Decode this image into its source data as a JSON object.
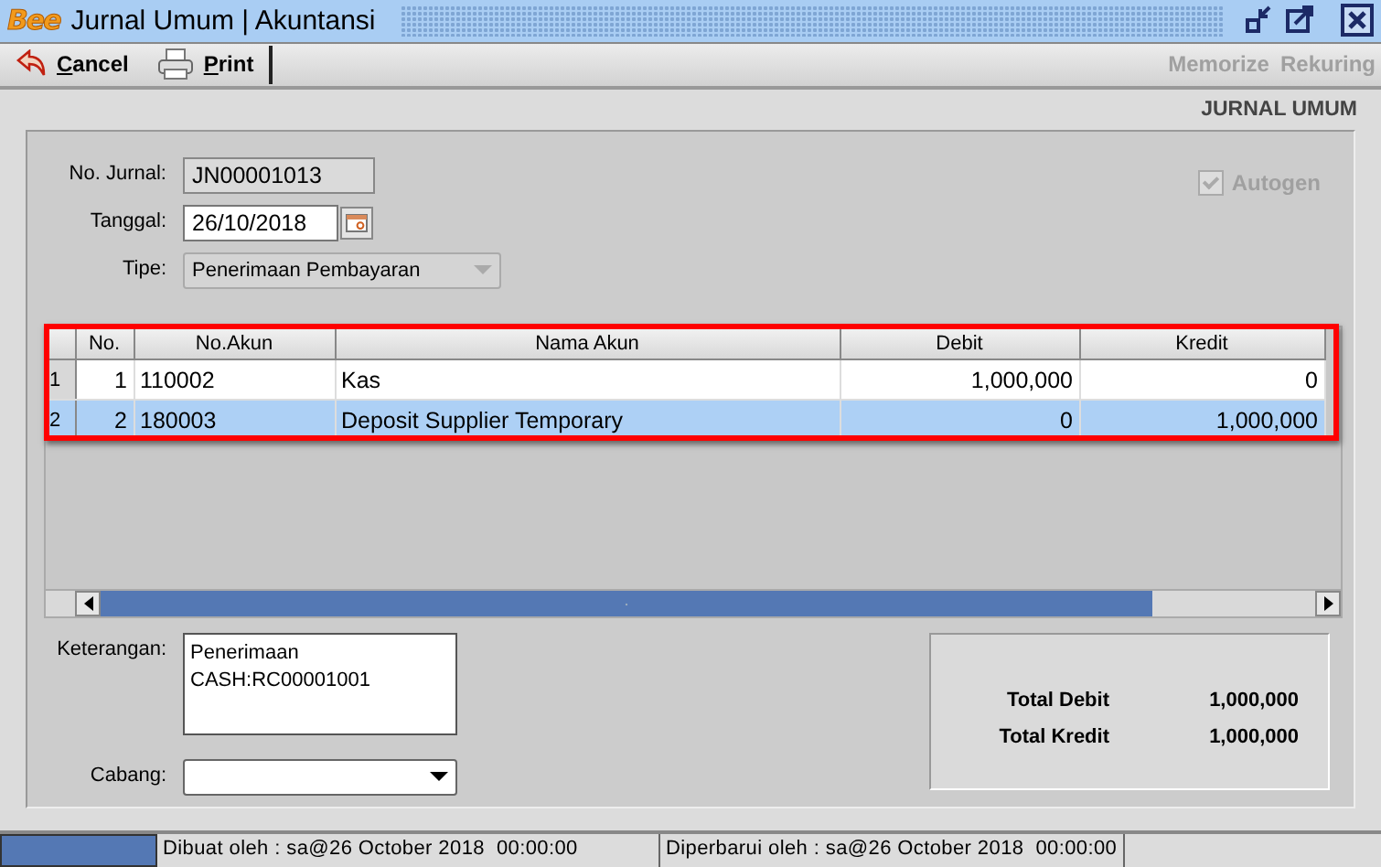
{
  "window": {
    "logo": "Bee",
    "title": "Jurnal Umum | Akuntansi"
  },
  "toolbar": {
    "left": [
      {
        "label": "Cancel"
      },
      {
        "label": "Print"
      }
    ],
    "right": [
      {
        "label": "Memorize",
        "disabled": true
      },
      {
        "label": "Rekuring",
        "disabled": true
      }
    ]
  },
  "form": {
    "heading": "JURNAL UMUM",
    "no_jurnal": {
      "label": "No. Jurnal:",
      "value": "JN00001013",
      "disabled": true
    },
    "tanggal": {
      "label": "Tanggal:",
      "value": "26/10/2018"
    },
    "tipe": {
      "label": "Tipe:",
      "value": "Penerimaan Pembayaran",
      "disabled": true
    },
    "autogen": {
      "label": "Autogen",
      "checked": true,
      "disabled": true
    }
  },
  "grid": {
    "highlighted": true,
    "columns": [
      "No.",
      "No.Akun",
      "Nama Akun",
      "Debit",
      "Kredit"
    ],
    "rows": [
      {
        "row_header": "1",
        "cells": [
          "1",
          "110002",
          "Kas",
          "1,000,000",
          "0"
        ],
        "selected": false
      },
      {
        "row_header": "2",
        "cells": [
          "2",
          "180003",
          "Deposit Supplier Temporary",
          "0",
          "1,000,000"
        ],
        "selected": true
      }
    ]
  },
  "keterangan": {
    "label": "Keterangan:",
    "value": "Penerimaan\nCASH:RC00001001"
  },
  "cabang": {
    "label": "Cabang:"
  },
  "totals": [
    {
      "label": "Total Debit",
      "value": "1,000,000"
    },
    {
      "label": "Total Kredit",
      "value": "1,000,000"
    }
  ],
  "status_bar": {
    "created": "Dibuat oleh : sa@26 October 2018  00:00:00",
    "updated": "Diperbarui oleh : sa@26 October 2018  00:00:00"
  }
}
